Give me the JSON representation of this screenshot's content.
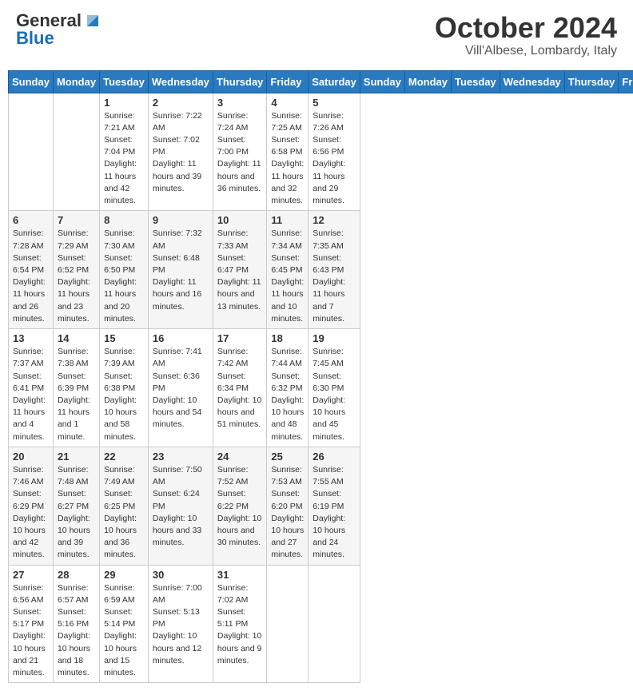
{
  "header": {
    "logo_general": "General",
    "logo_blue": "Blue",
    "month": "October 2024",
    "location": "Vill'Albese, Lombardy, Italy"
  },
  "days_of_week": [
    "Sunday",
    "Monday",
    "Tuesday",
    "Wednesday",
    "Thursday",
    "Friday",
    "Saturday"
  ],
  "weeks": [
    [
      {
        "day": "",
        "info": ""
      },
      {
        "day": "",
        "info": ""
      },
      {
        "day": "1",
        "info": "Sunrise: 7:21 AM\nSunset: 7:04 PM\nDaylight: 11 hours and 42 minutes."
      },
      {
        "day": "2",
        "info": "Sunrise: 7:22 AM\nSunset: 7:02 PM\nDaylight: 11 hours and 39 minutes."
      },
      {
        "day": "3",
        "info": "Sunrise: 7:24 AM\nSunset: 7:00 PM\nDaylight: 11 hours and 36 minutes."
      },
      {
        "day": "4",
        "info": "Sunrise: 7:25 AM\nSunset: 6:58 PM\nDaylight: 11 hours and 32 minutes."
      },
      {
        "day": "5",
        "info": "Sunrise: 7:26 AM\nSunset: 6:56 PM\nDaylight: 11 hours and 29 minutes."
      }
    ],
    [
      {
        "day": "6",
        "info": "Sunrise: 7:28 AM\nSunset: 6:54 PM\nDaylight: 11 hours and 26 minutes."
      },
      {
        "day": "7",
        "info": "Sunrise: 7:29 AM\nSunset: 6:52 PM\nDaylight: 11 hours and 23 minutes."
      },
      {
        "day": "8",
        "info": "Sunrise: 7:30 AM\nSunset: 6:50 PM\nDaylight: 11 hours and 20 minutes."
      },
      {
        "day": "9",
        "info": "Sunrise: 7:32 AM\nSunset: 6:48 PM\nDaylight: 11 hours and 16 minutes."
      },
      {
        "day": "10",
        "info": "Sunrise: 7:33 AM\nSunset: 6:47 PM\nDaylight: 11 hours and 13 minutes."
      },
      {
        "day": "11",
        "info": "Sunrise: 7:34 AM\nSunset: 6:45 PM\nDaylight: 11 hours and 10 minutes."
      },
      {
        "day": "12",
        "info": "Sunrise: 7:35 AM\nSunset: 6:43 PM\nDaylight: 11 hours and 7 minutes."
      }
    ],
    [
      {
        "day": "13",
        "info": "Sunrise: 7:37 AM\nSunset: 6:41 PM\nDaylight: 11 hours and 4 minutes."
      },
      {
        "day": "14",
        "info": "Sunrise: 7:38 AM\nSunset: 6:39 PM\nDaylight: 11 hours and 1 minute."
      },
      {
        "day": "15",
        "info": "Sunrise: 7:39 AM\nSunset: 6:38 PM\nDaylight: 10 hours and 58 minutes."
      },
      {
        "day": "16",
        "info": "Sunrise: 7:41 AM\nSunset: 6:36 PM\nDaylight: 10 hours and 54 minutes."
      },
      {
        "day": "17",
        "info": "Sunrise: 7:42 AM\nSunset: 6:34 PM\nDaylight: 10 hours and 51 minutes."
      },
      {
        "day": "18",
        "info": "Sunrise: 7:44 AM\nSunset: 6:32 PM\nDaylight: 10 hours and 48 minutes."
      },
      {
        "day": "19",
        "info": "Sunrise: 7:45 AM\nSunset: 6:30 PM\nDaylight: 10 hours and 45 minutes."
      }
    ],
    [
      {
        "day": "20",
        "info": "Sunrise: 7:46 AM\nSunset: 6:29 PM\nDaylight: 10 hours and 42 minutes."
      },
      {
        "day": "21",
        "info": "Sunrise: 7:48 AM\nSunset: 6:27 PM\nDaylight: 10 hours and 39 minutes."
      },
      {
        "day": "22",
        "info": "Sunrise: 7:49 AM\nSunset: 6:25 PM\nDaylight: 10 hours and 36 minutes."
      },
      {
        "day": "23",
        "info": "Sunrise: 7:50 AM\nSunset: 6:24 PM\nDaylight: 10 hours and 33 minutes."
      },
      {
        "day": "24",
        "info": "Sunrise: 7:52 AM\nSunset: 6:22 PM\nDaylight: 10 hours and 30 minutes."
      },
      {
        "day": "25",
        "info": "Sunrise: 7:53 AM\nSunset: 6:20 PM\nDaylight: 10 hours and 27 minutes."
      },
      {
        "day": "26",
        "info": "Sunrise: 7:55 AM\nSunset: 6:19 PM\nDaylight: 10 hours and 24 minutes."
      }
    ],
    [
      {
        "day": "27",
        "info": "Sunrise: 6:56 AM\nSunset: 5:17 PM\nDaylight: 10 hours and 21 minutes."
      },
      {
        "day": "28",
        "info": "Sunrise: 6:57 AM\nSunset: 5:16 PM\nDaylight: 10 hours and 18 minutes."
      },
      {
        "day": "29",
        "info": "Sunrise: 6:59 AM\nSunset: 5:14 PM\nDaylight: 10 hours and 15 minutes."
      },
      {
        "day": "30",
        "info": "Sunrise: 7:00 AM\nSunset: 5:13 PM\nDaylight: 10 hours and 12 minutes."
      },
      {
        "day": "31",
        "info": "Sunrise: 7:02 AM\nSunset: 5:11 PM\nDaylight: 10 hours and 9 minutes."
      },
      {
        "day": "",
        "info": ""
      },
      {
        "day": "",
        "info": ""
      }
    ]
  ]
}
